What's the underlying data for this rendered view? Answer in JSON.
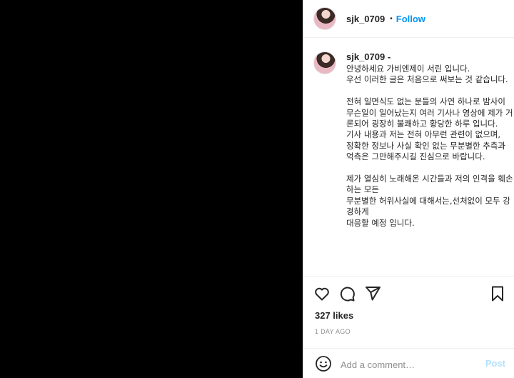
{
  "post": {
    "username": "sjk_0709",
    "follow_label": "Follow",
    "dot": "•",
    "caption_user": "sjk_0709 -",
    "caption_text": "안녕하세요 가비엔제이 서린 입니다.\n우선 이러한 글은 처음으로 써보는 것 같습니다.\n\n전혀 일면식도 없는 분들의 사연 하나로 밤사이 무슨일이 일어났는지 여러 기사나 영상에 제가 거론되어 굉장히 불쾌하고 황당한 하루 입니다.\n기사 내용과 저는 전혀 아무런 관련이 없으며,\n정확한 정보나 사실 확인 없는 무분별한 추측과 억측은 그만해주시길 진심으로 바랍니다.\n\n제가 열심히 노래해온 시간들과 저의 인격을 훼손하는 모든\n무분별한 허위사실에 대해서는,선처없이 모두 강경하게\n대응할 예정 입니다.",
    "likes": "327 likes",
    "time": "1 DAY AGO",
    "comment_placeholder": "Add a comment…",
    "post_label": "Post"
  },
  "icons": {
    "like": "heart-icon",
    "comment": "comment-icon",
    "share": "paper-plane-icon",
    "save": "bookmark-icon",
    "emoji": "smiley-icon"
  },
  "colors": {
    "accent": "#0095f6",
    "post_disabled": "#b2dffc",
    "muted": "#8e8e8e",
    "text": "#262626"
  }
}
